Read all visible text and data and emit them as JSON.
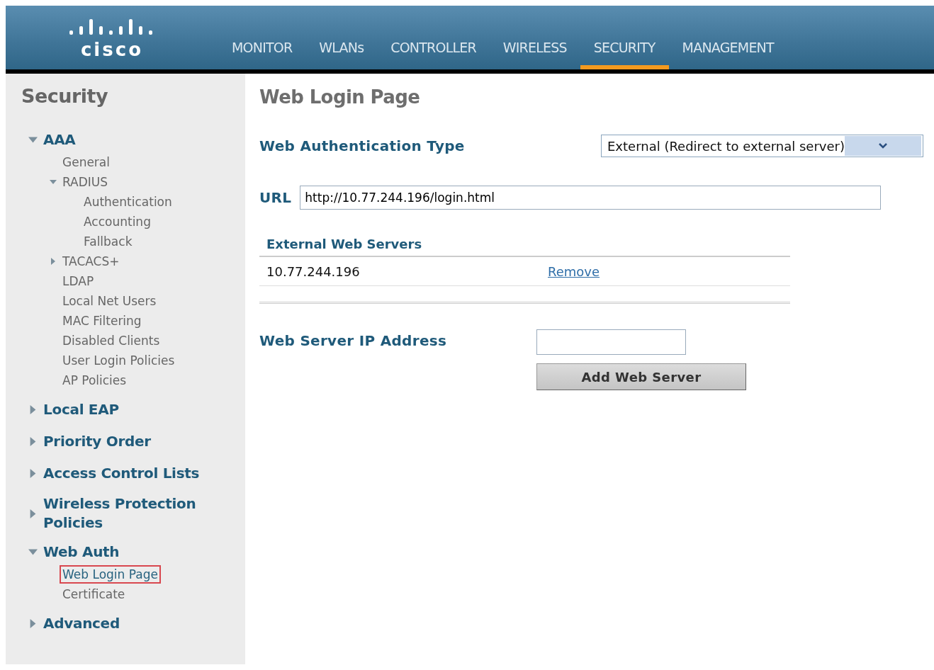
{
  "header": {
    "logo": "cisco",
    "tabs": [
      {
        "label": "MONITOR",
        "selected": false
      },
      {
        "label": "WLANs",
        "selected": false
      },
      {
        "label": "CONTROLLER",
        "selected": false
      },
      {
        "label": "WIRELESS",
        "selected": false
      },
      {
        "label": "SECURITY",
        "selected": true
      },
      {
        "label": "MANAGEMENT",
        "selected": false
      }
    ]
  },
  "sidebar": {
    "title": "Security",
    "items": [
      {
        "label": "AAA",
        "kind": "section",
        "expanded": true,
        "children": [
          {
            "label": "General",
            "selected": false
          },
          {
            "label": "RADIUS",
            "expanded": true,
            "selected": false,
            "children": [
              {
                "label": "Authentication",
                "selected": false
              },
              {
                "label": "Accounting",
                "selected": false
              },
              {
                "label": "Fallback",
                "selected": false
              }
            ]
          },
          {
            "label": "TACACS+",
            "expanded": false,
            "selected": false
          },
          {
            "label": "LDAP",
            "selected": false
          },
          {
            "label": "Local Net Users",
            "selected": false
          },
          {
            "label": "MAC Filtering",
            "selected": false
          },
          {
            "label": "Disabled Clients",
            "selected": false
          },
          {
            "label": "User Login Policies",
            "selected": false
          },
          {
            "label": "AP Policies",
            "selected": false
          }
        ]
      },
      {
        "label": "Local EAP",
        "kind": "section",
        "expanded": false
      },
      {
        "label": "Priority Order",
        "kind": "section",
        "expanded": false
      },
      {
        "label": "Access Control Lists",
        "kind": "section",
        "expanded": false
      },
      {
        "label": "Wireless Protection Policies",
        "kind": "section",
        "expanded": false
      },
      {
        "label": "Web Auth",
        "kind": "section",
        "expanded": true,
        "children": [
          {
            "label": "Web Login Page",
            "selected": true
          },
          {
            "label": "Certificate",
            "selected": false
          }
        ]
      },
      {
        "label": "Advanced",
        "kind": "section",
        "expanded": false
      }
    ]
  },
  "content": {
    "title": "Web Login Page",
    "auth_type": {
      "label": "Web Authentication Type",
      "value": "External (Redirect to external server)"
    },
    "url": {
      "label": "URL",
      "value": "http://10.77.244.196/login.html"
    },
    "servers": {
      "heading": "External Web Servers",
      "rows": [
        {
          "address": "10.77.244.196",
          "action": "Remove"
        }
      ]
    },
    "server_ip": {
      "label": "Web Server IP Address"
    },
    "add_button": "Add Web Server"
  }
}
